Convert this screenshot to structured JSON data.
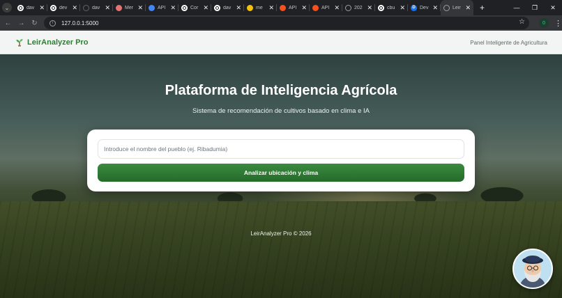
{
  "browser": {
    "tabs": [
      {
        "title": "dav",
        "icon": "github-icon",
        "color": "#ffffff"
      },
      {
        "title": "dev",
        "icon": "github-icon",
        "color": "#ffffff"
      },
      {
        "title": "dav",
        "icon": "loading-icon",
        "color": "#5f6368"
      },
      {
        "title": "Mer",
        "icon": "red-dot-icon",
        "color": "#e57373"
      },
      {
        "title": "API",
        "icon": "blue-icon",
        "color": "#4285f4"
      },
      {
        "title": "Cor",
        "icon": "github-icon",
        "color": "#ffffff"
      },
      {
        "title": "dav",
        "icon": "github-icon",
        "color": "#ffffff"
      },
      {
        "title": "me",
        "icon": "yellow-face-icon",
        "color": "#f4c20d"
      },
      {
        "title": "API",
        "icon": "orange-icon",
        "color": "#f4511e"
      },
      {
        "title": "API",
        "icon": "orange-icon",
        "color": "#f4511e"
      },
      {
        "title": "202",
        "icon": "globe-icon",
        "color": "#9aa0a6"
      },
      {
        "title": "cbu",
        "icon": "github-icon",
        "color": "#ffffff"
      },
      {
        "title": "Dev",
        "icon": "d-icon",
        "color": "#1a73e8"
      },
      {
        "title": "Leir",
        "icon": "globe-icon",
        "color": "#9aa0a6",
        "active": true
      }
    ],
    "new_tab": "+",
    "url": "127.0.0.1:5000",
    "extension_badge": "0"
  },
  "header": {
    "brand": "LeirAnalyzer Pro",
    "subtitle": "Panel Inteligente de Agricultura",
    "brand_color": "#2e7d32"
  },
  "hero": {
    "title": "Plataforma de Inteligencia Agrícola",
    "subtitle": "Sistema de recomendación de cultivos basado en clima e IA"
  },
  "search": {
    "value": "",
    "placeholder": "Introduce el nombre del pueblo (ej. Ribadumia)",
    "button_label": "Analizar ubicación y clima",
    "button_color": "#2e7d32"
  },
  "footer": {
    "text": "LeirAnalyzer Pro © 2026"
  }
}
